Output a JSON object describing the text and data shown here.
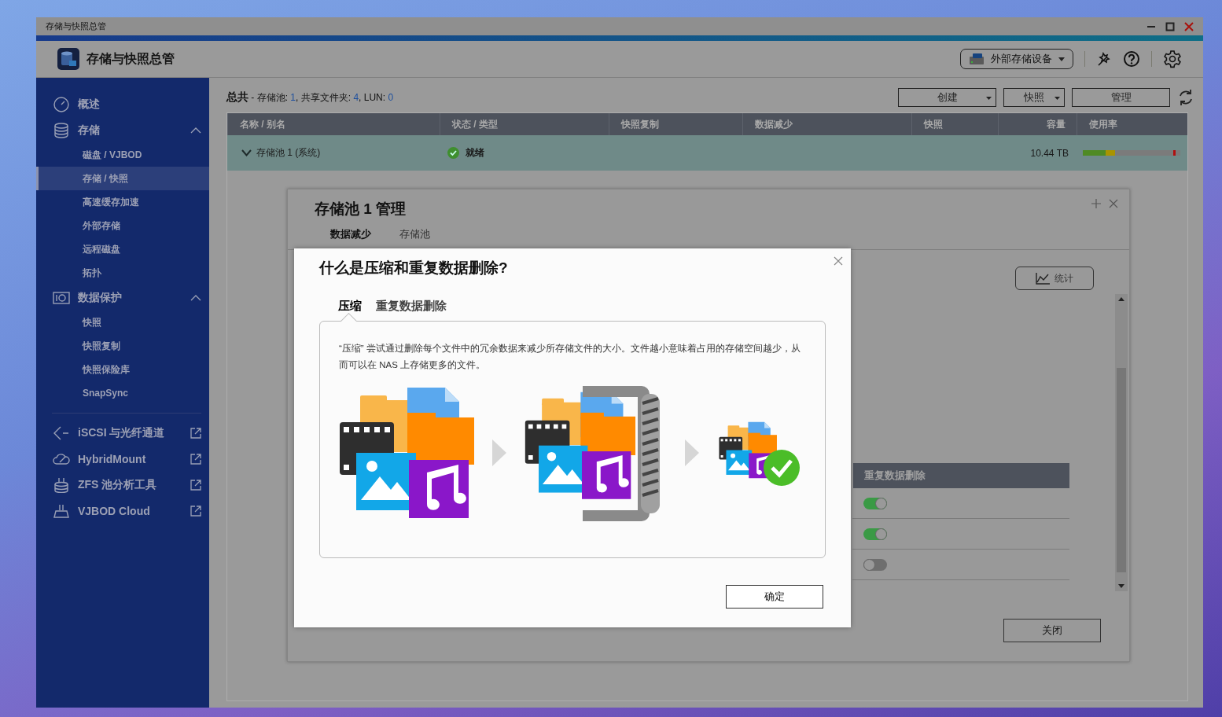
{
  "window": {
    "title": "存储与快照总管"
  },
  "header": {
    "app_title": "存储与快照总管",
    "device_button": "外部存储设备"
  },
  "sidebar": {
    "items": [
      {
        "kind": "item",
        "label": "概述",
        "selected": false
      },
      {
        "kind": "group",
        "label": "存储",
        "expanded": true,
        "selected": false,
        "children": [
          {
            "label": "磁盘 / VJBOD",
            "selected": false
          },
          {
            "label": "存储 / 快照",
            "selected": true
          },
          {
            "label": "高速缓存加速",
            "selected": false
          },
          {
            "label": "外部存储",
            "selected": false
          },
          {
            "label": "远程磁盘",
            "selected": false
          },
          {
            "label": "拓扑",
            "selected": false
          }
        ]
      },
      {
        "kind": "group",
        "label": "数据保护",
        "expanded": true,
        "selected": false,
        "children": [
          {
            "label": "快照",
            "selected": false
          },
          {
            "label": "快照复制",
            "selected": false
          },
          {
            "label": "快照保险库",
            "selected": false
          },
          {
            "label": "SnapSync",
            "selected": false
          }
        ]
      },
      {
        "kind": "divider"
      },
      {
        "kind": "external",
        "label": "iSCSI 与光纤通道",
        "selected": false
      },
      {
        "kind": "external",
        "label": "HybridMount",
        "selected": false
      },
      {
        "kind": "external",
        "label": "ZFS 池分析工具",
        "selected": false
      },
      {
        "kind": "external",
        "label": "VJBOD Cloud",
        "selected": false
      }
    ]
  },
  "summary": {
    "title": "总共",
    "parts": [
      {
        "label": " - 存储池: ",
        "value": "1"
      },
      {
        "label": ", 共享文件夹: ",
        "value": "4"
      },
      {
        "label": ", LUN: ",
        "value": "0"
      }
    ]
  },
  "toolbar": [
    {
      "label": "创建",
      "kind": "dropdown"
    },
    {
      "label": "快照",
      "kind": "dropdown"
    },
    {
      "label": "管理",
      "kind": "plain"
    }
  ],
  "table": {
    "columns": [
      "名称 / 别名",
      "状态 / 类型",
      "快照复制",
      "数据减少",
      "快照",
      "容量",
      "使用率"
    ],
    "rows": [
      {
        "name": "存储池 1 (系统)",
        "expanded": true,
        "status": "就绪",
        "capacity": "10.44 TB",
        "usage": {
          "level": 0.33
        }
      }
    ]
  },
  "manage_dialog": {
    "title": "存储池 1 管理",
    "tabs": [
      {
        "label": "数据减少",
        "selected": true
      },
      {
        "label": "存储池",
        "selected": false
      }
    ],
    "stats_button": "统计",
    "table": {
      "column": "重复数据删除",
      "rows": [
        {
          "on": true
        },
        {
          "on": true
        },
        {
          "on": false
        }
      ]
    },
    "close_button": "关闭"
  },
  "info_dialog": {
    "title": "什么是压缩和重复数据删除?",
    "tabs": [
      {
        "label": "压缩",
        "selected": true
      },
      {
        "label": "重复数据删除",
        "selected": false
      }
    ],
    "description": "“压缩” 尝试通过删除每个文件中的冗余数据来减少所存储文件的大小。文件越小意味着占用的存储空间越少，从而可以在 NAS 上存储更多的文件。",
    "ok_button": "确定"
  }
}
